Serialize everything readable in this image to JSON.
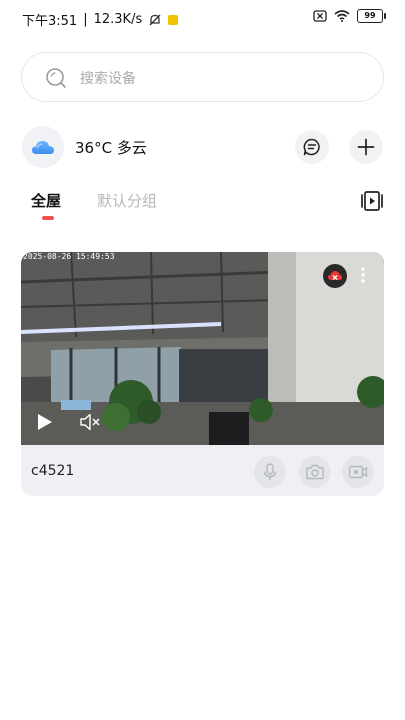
{
  "status_bar": {
    "time": "下午3:51",
    "separator": "|",
    "speed": "12.3K/s",
    "battery": "99"
  },
  "search": {
    "placeholder": "搜索设备"
  },
  "weather": {
    "text": "36°C 多云"
  },
  "tabs": [
    {
      "label": "全屋",
      "active": true
    },
    {
      "label": "默认分组",
      "active": false
    }
  ],
  "device": {
    "name": "c4521",
    "timestamp": "2025-08-26 15:49:53"
  },
  "icons": {
    "weather": "cloud-icon",
    "message": "message-icon",
    "add": "plus-icon",
    "layout": "layout-switch-icon",
    "cloud_storage": "cloud-off-icon",
    "more": "more-vertical-icon",
    "play": "play-icon",
    "mute": "speaker-mute-icon",
    "mic": "microphone-icon",
    "snapshot": "camera-icon",
    "record": "video-record-icon"
  },
  "colors": {
    "accent": "#f0524b",
    "cloud_alert": "#e53935"
  }
}
